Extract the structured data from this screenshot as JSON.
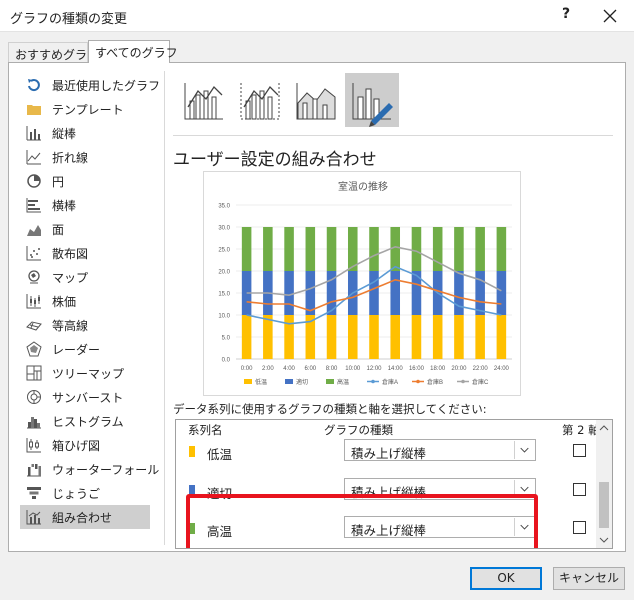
{
  "dialog": {
    "title": "グラフの種類の変更",
    "help": "?",
    "tabs": [
      {
        "label": "おすすめグラフ"
      },
      {
        "label": "すべてのグラフ"
      }
    ]
  },
  "sidebar": {
    "items": [
      {
        "label": "最近使用したグラフ",
        "icon": "recent-icon"
      },
      {
        "label": "テンプレート",
        "icon": "folder-icon"
      },
      {
        "label": "縦棒",
        "icon": "column-chart-icon"
      },
      {
        "label": "折れ線",
        "icon": "line-chart-icon"
      },
      {
        "label": "円",
        "icon": "pie-chart-icon"
      },
      {
        "label": "横棒",
        "icon": "bar-chart-icon"
      },
      {
        "label": "面",
        "icon": "area-chart-icon"
      },
      {
        "label": "散布図",
        "icon": "scatter-chart-icon"
      },
      {
        "label": "マップ",
        "icon": "map-chart-icon"
      },
      {
        "label": "株価",
        "icon": "stock-chart-icon"
      },
      {
        "label": "等高線",
        "icon": "surface-chart-icon"
      },
      {
        "label": "レーダー",
        "icon": "radar-chart-icon"
      },
      {
        "label": "ツリーマップ",
        "icon": "treemap-chart-icon"
      },
      {
        "label": "サンバースト",
        "icon": "sunburst-chart-icon"
      },
      {
        "label": "ヒストグラム",
        "icon": "histogram-chart-icon"
      },
      {
        "label": "箱ひげ図",
        "icon": "boxwhisker-chart-icon"
      },
      {
        "label": "ウォーターフォール",
        "icon": "waterfall-chart-icon"
      },
      {
        "label": "じょうご",
        "icon": "funnel-chart-icon"
      },
      {
        "label": "組み合わせ",
        "icon": "combo-chart-icon"
      }
    ],
    "selected": "組み合わせ"
  },
  "main": {
    "combo_title": "ユーザー設定の組み合わせ",
    "prompt": "データ系列に使用するグラフの種類と軸を選択してください:",
    "table": {
      "headers": [
        "系列名",
        "グラフの種類",
        "第 2 軸"
      ],
      "rows": [
        {
          "name": "低温",
          "type": "積み上げ縦棒",
          "secondary": false,
          "color": "#ffc000"
        },
        {
          "name": "適切",
          "type": "積み上げ縦棒",
          "secondary": false,
          "color": "#4472c4"
        },
        {
          "name": "高温",
          "type": "積み上げ縦棒",
          "secondary": false,
          "color": "#70ad47"
        }
      ]
    }
  },
  "buttons": {
    "ok": "OK",
    "cancel": "キャンセル"
  },
  "chart_data": {
    "type": "bar",
    "title": "室温の推移",
    "categories": [
      "0:00",
      "2:00",
      "4:00",
      "6:00",
      "8:00",
      "10:00",
      "12:00",
      "14:00",
      "16:00",
      "18:00",
      "20:00",
      "22:00",
      "24:00"
    ],
    "ylim": [
      0,
      35
    ],
    "yticks": [
      "0.0",
      "5.0",
      "10.0",
      "15.0",
      "20.0",
      "25.0",
      "30.0",
      "35.0"
    ],
    "grid": true,
    "legend_position": "bottom",
    "series": [
      {
        "name": "低温",
        "kind": "stacked-bar",
        "color": "#ffc000",
        "values": [
          10,
          10,
          10,
          10,
          10,
          10,
          10,
          10,
          10,
          10,
          10,
          10,
          10
        ]
      },
      {
        "name": "適切",
        "kind": "stacked-bar",
        "color": "#4472c4",
        "values": [
          10,
          10,
          10,
          10,
          10,
          10,
          10,
          10,
          10,
          10,
          10,
          10,
          10
        ]
      },
      {
        "name": "高温",
        "kind": "stacked-bar",
        "color": "#70ad47",
        "values": [
          10,
          10,
          10,
          10,
          10,
          10,
          10,
          10,
          10,
          10,
          10,
          10,
          10
        ]
      },
      {
        "name": "倉庫A",
        "kind": "line",
        "color": "#5b9bd5",
        "values": [
          10,
          9,
          8,
          8.5,
          11,
          15,
          17.5,
          21,
          19,
          15,
          12,
          11,
          10
        ]
      },
      {
        "name": "倉庫B",
        "kind": "line",
        "color": "#ed7d31",
        "values": [
          13,
          12.5,
          12.5,
          11,
          13,
          14,
          16,
          18,
          17,
          15.5,
          14,
          13,
          12.5
        ]
      },
      {
        "name": "倉庫C",
        "kind": "line",
        "color": "#a5a5a5",
        "values": [
          15,
          15,
          14.5,
          16,
          18,
          21,
          23.5,
          25.5,
          24.5,
          22,
          19.5,
          18,
          15.5
        ]
      }
    ]
  }
}
